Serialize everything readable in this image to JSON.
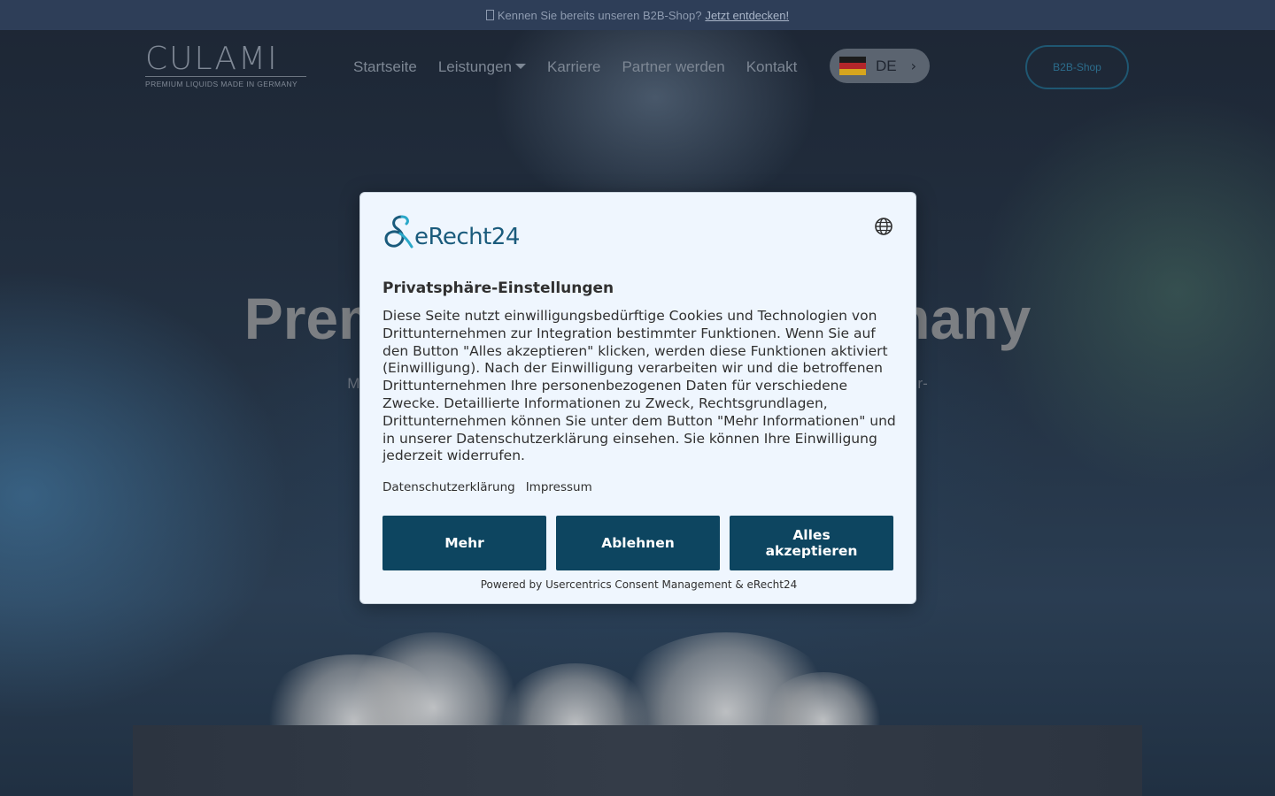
{
  "topbar": {
    "text": "Kennen Sie bereits unseren B2B-Shop?",
    "link": "Jetzt entdecken!"
  },
  "header": {
    "logo_word": "CULAMI",
    "logo_tagline": "PREMIUM LIQUIDS MADE IN GERMANY",
    "nav": [
      "Startseite",
      "Leistungen",
      "Karriere",
      "Partner werden",
      "Kontakt"
    ],
    "language": "DE",
    "b2b_button": "B2B-Shop"
  },
  "hero": {
    "title_left": "Premiu",
    "title_right": "ermany",
    "subtitle_left": "M",
    "subtitle_right": "r-"
  },
  "consent": {
    "brand": "eRecht24",
    "title": "Privatsphäre-Einstellungen",
    "body": "Diese Seite nutzt einwilligungsbedürftige Cookies und Technologien von Drittunternehmen zur Integration bestimmter Funktionen. Wenn Sie auf den Button \"Alles akzeptieren\" klicken, werden diese Funktionen aktiviert (Einwilligung). Nach der Einwilligung verarbeiten wir und die betroffenen Drittunternehmen Ihre personenbezogenen Daten für verschiedene Zwecke. Detaillierte Informationen zu Zweck, Rechtsgrundlagen, Drittunternehmen können Sie unter dem Button \"Mehr Informationen\" und in unserer Datenschutzerklärung einsehen. Sie können Ihre Einwilligung jederzeit widerrufen.",
    "links": [
      "Datenschutzerklärung",
      "Impressum"
    ],
    "buttons": {
      "more": "Mehr",
      "reject": "Ablehnen",
      "accept": "Alles akzeptieren"
    },
    "footer": "Powered by Usercentrics Consent Management & eRecht24"
  },
  "colors": {
    "primary_button": "#0d4560",
    "brand": "#1a5b7c",
    "modal_bg": "#eff6fe",
    "topbar_bg": "#2e3e58"
  },
  "icons": {
    "topbar": "info-icon",
    "language_flag": "germany-flag-icon",
    "language_arrow": "chevron-right-icon",
    "nav_dropdown": "caret-down-icon",
    "language_select": "globe-icon"
  }
}
